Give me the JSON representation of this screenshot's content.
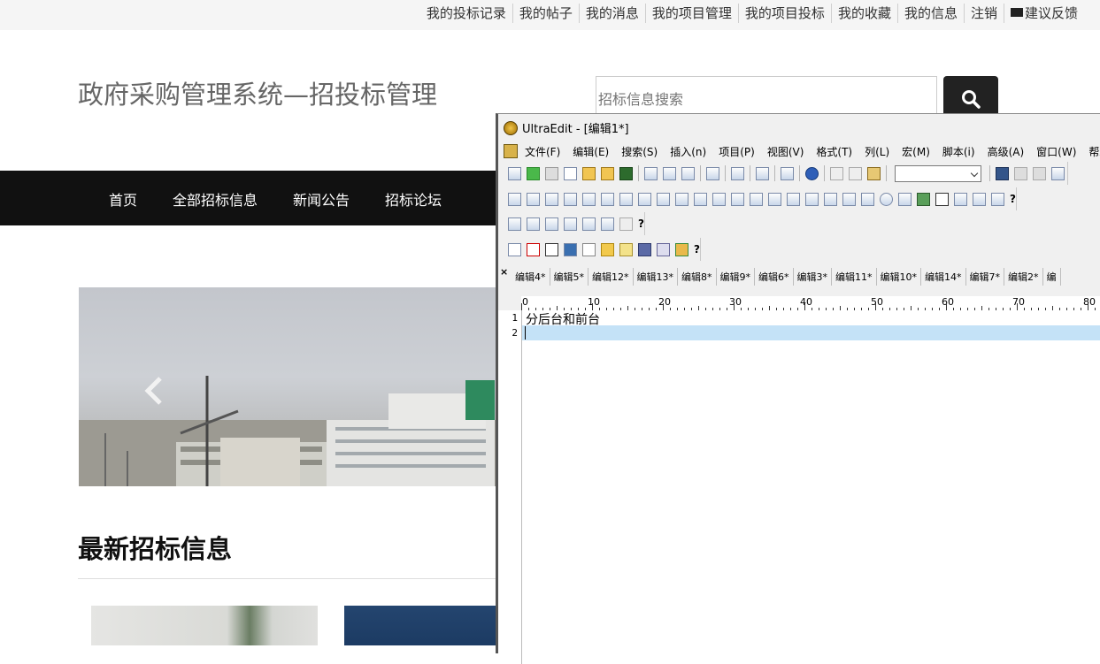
{
  "topbar": {
    "links": [
      "我的投标记录",
      "我的帖子",
      "我的消息",
      "我的项目管理",
      "我的项目投标",
      "我的收藏",
      "我的信息",
      "注销",
      "建议反馈"
    ]
  },
  "site": {
    "title": "政府采购管理系统—招投标管理"
  },
  "search": {
    "placeholder": "招标信息搜索"
  },
  "nav": {
    "items": [
      "首页",
      "全部招标信息",
      "新闻公告",
      "招标论坛"
    ]
  },
  "section": {
    "title": "最新招标信息"
  },
  "editor": {
    "window_title": "UltraEdit - [编辑1*]",
    "menu": [
      "文件(F)",
      "编辑(E)",
      "搜索(S)",
      "插入(n)",
      "项目(P)",
      "视图(V)",
      "格式(T)",
      "列(L)",
      "宏(M)",
      "脚本(i)",
      "高级(A)",
      "窗口(W)",
      "帮助(H)"
    ],
    "tabs": [
      "编辑4*",
      "编辑5*",
      "编辑12*",
      "编辑13*",
      "编辑8*",
      "编辑9*",
      "编辑6*",
      "编辑3*",
      "编辑11*",
      "编辑10*",
      "编辑14*",
      "编辑7*",
      "编辑2*",
      "编"
    ],
    "ruler_labels": [
      "0",
      "10",
      "20",
      "30",
      "40",
      "50",
      "60",
      "70",
      "80"
    ],
    "line_numbers": [
      "1",
      "2"
    ],
    "lines": [
      "分后台和前台",
      ""
    ],
    "help_glyph": "?",
    "close_glyph": "×"
  },
  "colors": {
    "nav_bg": "#111111",
    "topbar_bg": "#f5f5f5",
    "current_line": "#c4e2f7"
  }
}
